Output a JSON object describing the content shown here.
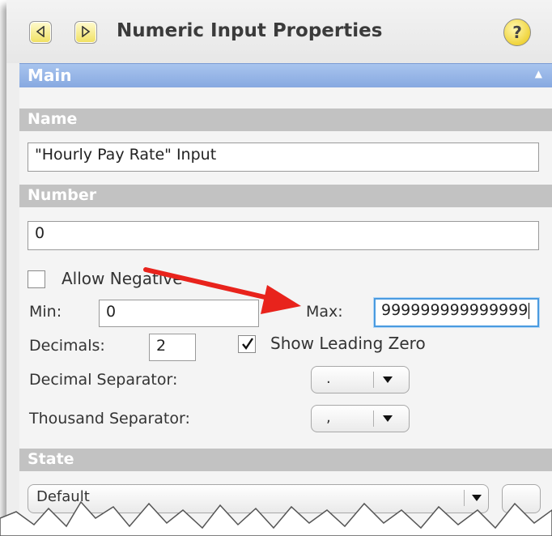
{
  "window": {
    "title": "Numeric Input Properties",
    "back_icon": "triangle-left-icon",
    "forward_icon": "triangle-right-icon",
    "help_label": "?"
  },
  "main_panel": {
    "label": "Main",
    "collapse_icon": "triangle-up-icon"
  },
  "sections": {
    "name": {
      "header": "Name",
      "value": "\"Hourly Pay Rate\" Input"
    },
    "number": {
      "header": "Number",
      "value": "0",
      "allow_negative": {
        "label": "Allow Negative",
        "checked": false
      },
      "min": {
        "label": "Min:",
        "value": "0"
      },
      "max": {
        "label": "Max:",
        "value": "999999999999999"
      },
      "decimals": {
        "label": "Decimals:",
        "value": "2"
      },
      "show_leading_zero": {
        "label": "Show Leading Zero",
        "checked": true
      },
      "decimal_separator": {
        "label": "Decimal Separator:",
        "value": "."
      },
      "thousand_separator": {
        "label": "Thousand Separator:",
        "value": ","
      }
    },
    "state": {
      "header": "State",
      "value": "Default"
    }
  },
  "annotation": {
    "arrow_color": "#e8231c",
    "points_to": "max-field"
  },
  "colors": {
    "main_header": "#8fb0e6",
    "section_header": "#c2c2c2",
    "focus_border": "#4a9be0",
    "nav_button": "#f4e878"
  }
}
